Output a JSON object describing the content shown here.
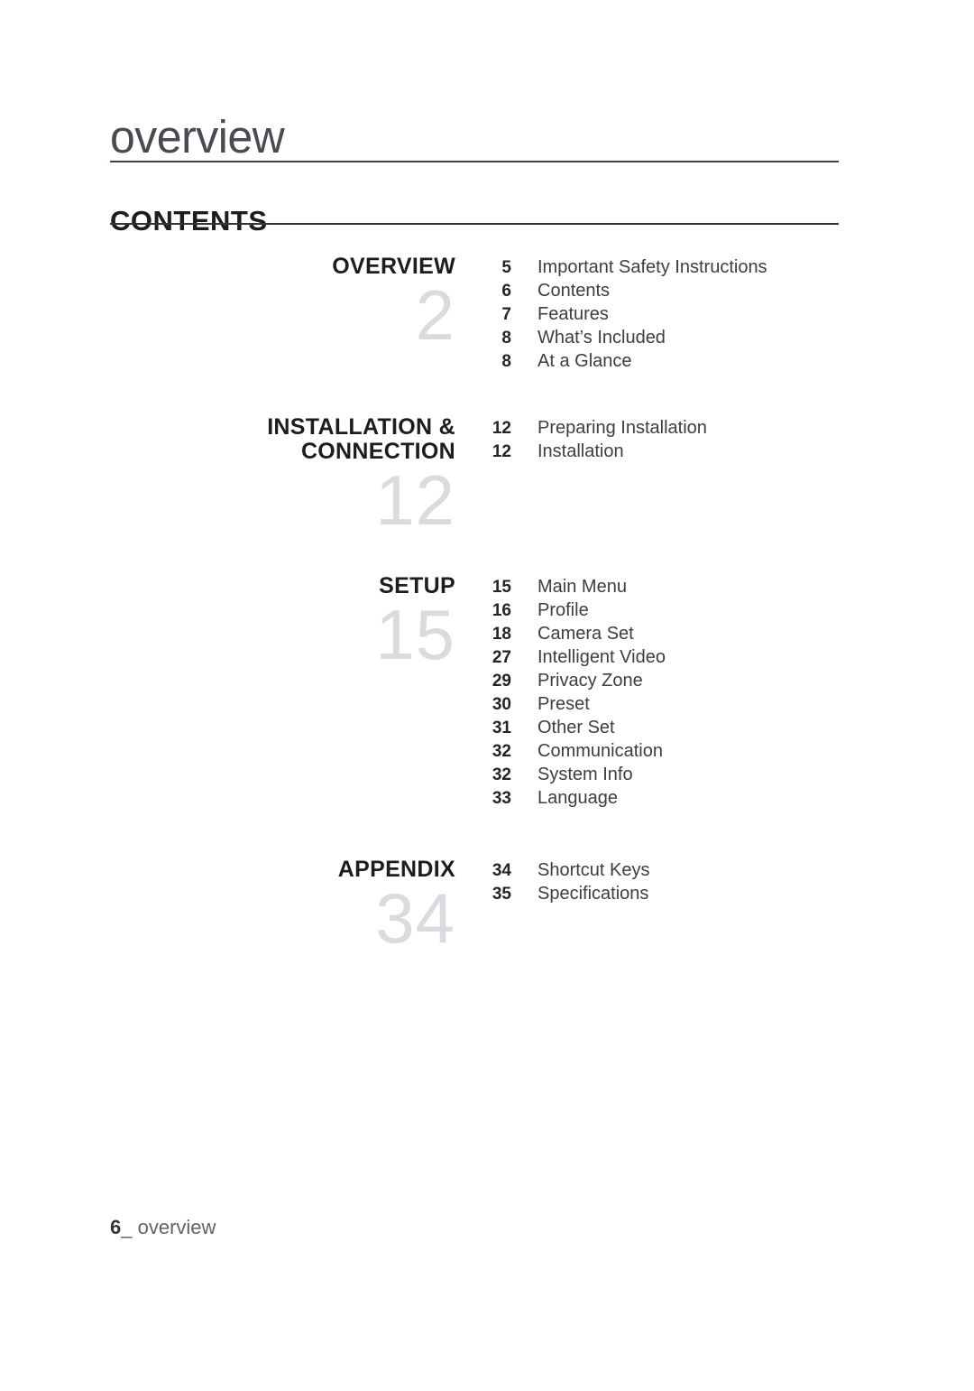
{
  "running_head": "overview",
  "section_title": "CONTENTS",
  "toc": {
    "blocks": [
      {
        "heading": "OVERVIEW",
        "big_number": "2",
        "entries": [
          {
            "page": "5",
            "title": "Important Safety Instructions"
          },
          {
            "page": "6",
            "title": "Contents"
          },
          {
            "page": "7",
            "title": "Features"
          },
          {
            "page": "8",
            "title": "What’s Included"
          },
          {
            "page": "8",
            "title": "At a Glance"
          }
        ]
      },
      {
        "heading": "INSTALLATION & CONNECTION",
        "heading_line1": "INSTALLATION &",
        "heading_line2": "CONNECTION",
        "big_number": "12",
        "entries": [
          {
            "page": "12",
            "title": "Preparing Installation"
          },
          {
            "page": "12",
            "title": "Installation"
          }
        ]
      },
      {
        "heading": "SETUP",
        "big_number": "15",
        "entries": [
          {
            "page": "15",
            "title": "Main Menu"
          },
          {
            "page": "16",
            "title": "Profile"
          },
          {
            "page": "18",
            "title": "Camera Set"
          },
          {
            "page": "27",
            "title": "Intelligent Video"
          },
          {
            "page": "29",
            "title": "Privacy Zone"
          },
          {
            "page": "30",
            "title": "Preset"
          },
          {
            "page": "31",
            "title": "Other Set"
          },
          {
            "page": "32",
            "title": "Communication"
          },
          {
            "page": "32",
            "title": "System Info"
          },
          {
            "page": "33",
            "title": "Language"
          }
        ]
      },
      {
        "heading": "APPENDIX",
        "big_number": "34",
        "entries": [
          {
            "page": "34",
            "title": "Shortcut Keys"
          },
          {
            "page": "35",
            "title": "Specifications"
          }
        ]
      }
    ]
  },
  "footer": {
    "page_number": "6",
    "separator": "_",
    "label": "overview"
  },
  "colors": {
    "rule_head": "#4b3f46",
    "rule_title": "#33333a",
    "big_number": "#d9dbdf",
    "heading": "#1d1d1d",
    "entry_title": "#3d3d42",
    "footer_label": "#62626c"
  }
}
